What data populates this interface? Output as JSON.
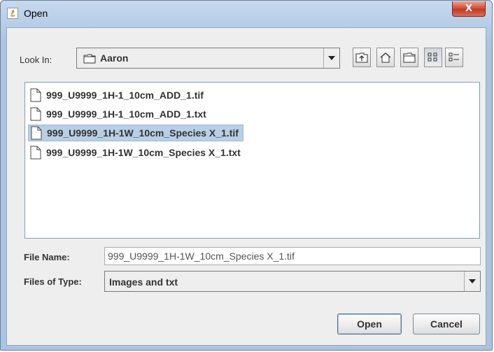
{
  "window": {
    "title": "Open",
    "close_label": "X"
  },
  "look_in": {
    "label": "Look In:",
    "value": "Aaron",
    "toolbar": {
      "buttons": [
        {
          "name": "up-one-level-icon"
        },
        {
          "name": "home-icon"
        },
        {
          "name": "new-folder-icon"
        },
        {
          "name": "list-view-icon",
          "pressed": true
        },
        {
          "name": "details-view-icon",
          "pressed": false
        }
      ]
    }
  },
  "files": [
    {
      "name": "999_U9999_1H-1_10cm_ADD_1.tif",
      "selected": false
    },
    {
      "name": "999_U9999_1H-1_10cm_ADD_1.txt",
      "selected": false
    },
    {
      "name": "999_U9999_1H-1W_10cm_Species X_1.tif",
      "selected": true
    },
    {
      "name": "999_U9999_1H-1W_10cm_Species X_1.txt",
      "selected": false
    }
  ],
  "file_name": {
    "label": "File Name:",
    "value": "999_U9999_1H-1W_10cm_Species X_1.tif"
  },
  "file_type": {
    "label": "Files of Type:",
    "value": "Images and txt"
  },
  "buttons": {
    "open": "Open",
    "cancel": "Cancel"
  },
  "colors": {
    "selection": "#b8cfe5",
    "title_bar": "#b9cfe8",
    "close": "#d9503a"
  }
}
